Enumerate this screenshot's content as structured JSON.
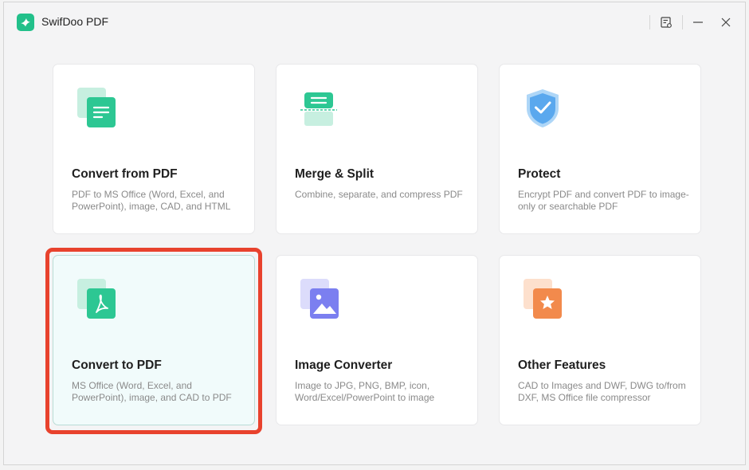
{
  "app": {
    "title": "SwifDoo PDF"
  },
  "titlebar": {
    "icons": [
      "settings-list-icon",
      "minimize-icon",
      "close-icon"
    ]
  },
  "colors": {
    "brand_green": "#22c08a",
    "protect_blue": "#5aa8ee",
    "image_purple": "#7b7ff0",
    "other_orange": "#f28a4c",
    "highlight_red": "#e8422d"
  },
  "cards": [
    {
      "title": "Convert from PDF",
      "desc": "PDF to MS Office (Word, Excel, and PowerPoint), image, CAD, and HTML",
      "icon": "convert-from-pdf-icon"
    },
    {
      "title": "Merge & Split",
      "desc": "Combine, separate, and compress PDF",
      "icon": "merge-split-icon"
    },
    {
      "title": "Protect",
      "desc": "Encrypt PDF and convert PDF to image-only or searchable PDF",
      "icon": "shield-icon"
    },
    {
      "title": "Convert to PDF",
      "desc": "MS Office (Word, Excel, and PowerPoint), image, and CAD to PDF",
      "icon": "convert-to-pdf-icon"
    },
    {
      "title": "Image Converter",
      "desc": "Image to JPG, PNG, BMP, icon, Word/Excel/PowerPoint to image",
      "icon": "image-icon"
    },
    {
      "title": "Other Features",
      "desc": "CAD to Images and DWF, DWG to/from DXF, MS Office file compressor",
      "icon": "star-icon"
    }
  ]
}
